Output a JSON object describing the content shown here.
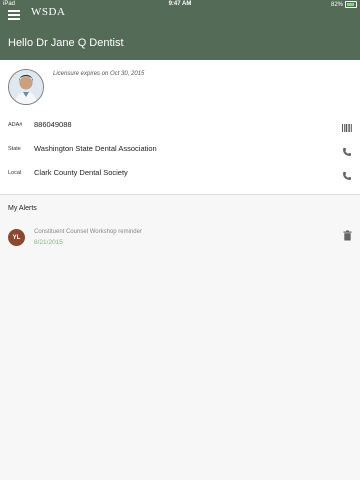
{
  "status_bar": {
    "device": "iPad",
    "time": "9:47 AM",
    "battery_percent": "82%",
    "battery_level": 0.82
  },
  "header": {
    "logo_text": "WSDA",
    "greeting": "Hello Dr Jane Q Dentist"
  },
  "profile": {
    "license_text": "Licensure expires on Oct 30, 2015",
    "rows": [
      {
        "label": "ADA#",
        "value": "886049088",
        "action_icon": "barcode-icon"
      },
      {
        "label": "State",
        "value": "Washington State Dental Association",
        "action_icon": "phone-icon"
      },
      {
        "label": "Local",
        "value": "Clark County Dental Society",
        "action_icon": "phone-icon"
      }
    ]
  },
  "alerts": {
    "title": "My Alerts",
    "items": [
      {
        "badge": "YL",
        "text": "Constituent Counsel Workshop reminder",
        "date": "8/21/2015"
      }
    ]
  },
  "colors": {
    "header_bg": "#546b57",
    "badge_bg": "#8b4a2f",
    "date_green": "#7fb884"
  }
}
